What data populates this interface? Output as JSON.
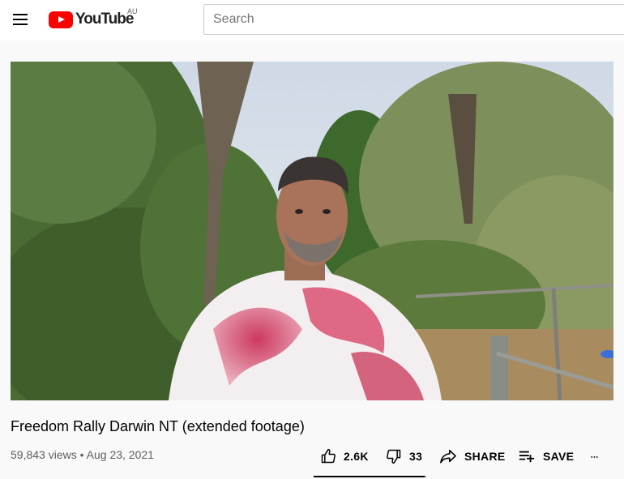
{
  "header": {
    "logo_text": "YouTube",
    "country_code": "AU",
    "search_placeholder": "Search"
  },
  "video": {
    "title": "Freedom Rally Darwin NT (extended footage)",
    "views": "59,843 views",
    "separator": "•",
    "date": "Aug 23, 2021"
  },
  "actions": {
    "likes": "2.6K",
    "dislikes": "33",
    "share_label": "SHARE",
    "save_label": "SAVE",
    "like_ratio": 0.987
  },
  "icons": {
    "menu": "hamburger-menu-icon",
    "like": "thumbs-up-icon",
    "dislike": "thumbs-down-icon",
    "share": "share-arrow-icon",
    "save": "playlist-add-icon",
    "more": "more-horizontal-icon"
  },
  "colors": {
    "brand_red": "#ff0000",
    "text_primary": "#030303",
    "text_secondary": "#606060"
  }
}
